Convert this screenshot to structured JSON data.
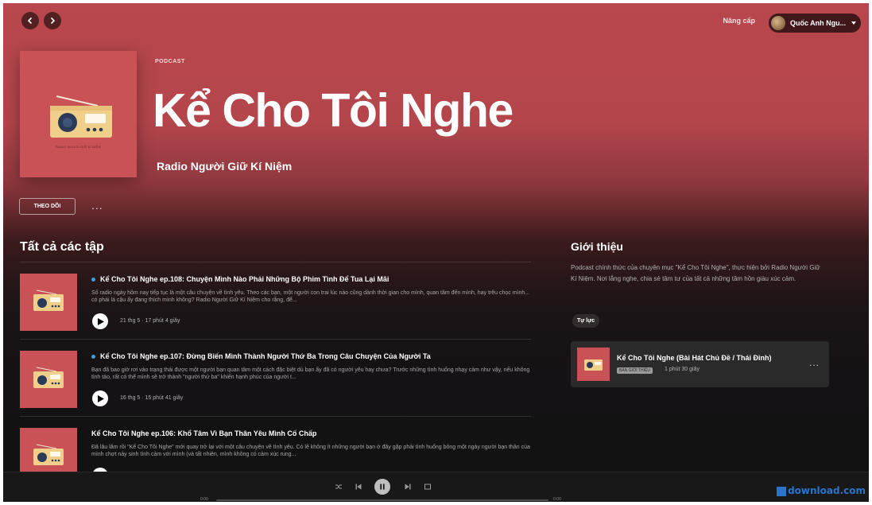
{
  "topbar": {
    "back_icon": "chevron-left-icon",
    "forward_icon": "chevron-right-icon",
    "upgrade_label": "Nâng cấp",
    "user_name": "Quốc Anh Ngu...",
    "user_menu_icon": "caret-down-icon"
  },
  "header": {
    "type_label": "PODCAST",
    "title": "Kể Cho Tôi Nghe",
    "publisher": "Radio Người Giữ Kí Niệm",
    "cover_caption": "RADIO NGƯỜI GIỮ KÍ NIỆM"
  },
  "actions": {
    "follow_label": "THEO DÕI",
    "more_label": "..."
  },
  "episodes": {
    "section_title": "Tất cả các tập",
    "items": [
      {
        "title": "Kể Cho Tôi Nghe ep.108: Chuyện Mình Nào Phải Những Bộ Phim Tình Để Tua Lại Mãi",
        "description": "Số radio ngày hôm nay tiếp tục là một câu chuyện về tình yêu. Theo các bạn, một người con trai lúc nào cũng dành thời gian cho mình, quan tâm đến mình, hay trêu chọc mình... có phải là cậu ấy đang thích mình không? Radio Người Giữ Kí Niệm cho rằng, để...",
        "meta": "21 thg 5 · 17 phút 4 giây",
        "is_new": true
      },
      {
        "title": "Kể Cho Tôi Nghe ep.107: Đừng Biến Mình Thành Người Thứ Ba Trong Câu Chuyện Của Người Ta",
        "description": "Bạn đã bao giờ rơi vào trạng thái được một người bạn quan tâm một cách đặc biệt dù bạn ấy đã có người yêu hay chưa? Trước những tình huống nhạy cảm như vậy, nếu không tỉnh táo, rất có thể mình sẽ trở thành \"người thứ ba\" khiến hạnh phúc của người t...",
        "meta": "16 thg 5 · 15 phút 41 giây",
        "is_new": true
      },
      {
        "title": "Kể Cho Tôi Nghe ep.106: Khổ Tâm Vì Bạn Thân Yêu Mình Cố Chấp",
        "description": "Đã lâu lắm rồi \"Kể Cho Tôi Nghe\" mới quay trở lại với một câu chuyện về tình yêu. Có lẽ không ít những người bạn ở đây gặp phải tình huống bỗng một ngày người bạn thân của mình chợt nảy sinh tình cảm với mình (và tất nhiên, mình không có cảm xúc rung...",
        "meta": "",
        "is_new": false
      }
    ]
  },
  "about": {
    "title": "Giới thiệu",
    "text": "Podcast chính thức của chuyên mục \"Kể Cho Tôi Nghe\", thực hiện bởi Radio Người Giữ Kí Niệm. Nơi lắng nghe, chia sẻ tâm tư của tất cả những tâm hồn giàu xúc cảm.",
    "tag": "Tự lực",
    "trailer": {
      "title": "Kể Cho Tôi Nghe (Bài Hát Chủ Đề / Thái Đinh)",
      "badge": "BẢN GIỚI THIỆU",
      "duration": "1 phút 30 giây",
      "more_label": "..."
    }
  },
  "player": {
    "time_elapsed": "0:00",
    "time_total": "0:00",
    "progress": 0,
    "controls": [
      "shuffle-icon",
      "previous-icon",
      "pause-icon",
      "next-icon",
      "queue-icon"
    ]
  },
  "watermark": "download.com",
  "colors": {
    "accent": "#c95256",
    "new_dot": "#3aa0e0",
    "background": "#121212"
  }
}
